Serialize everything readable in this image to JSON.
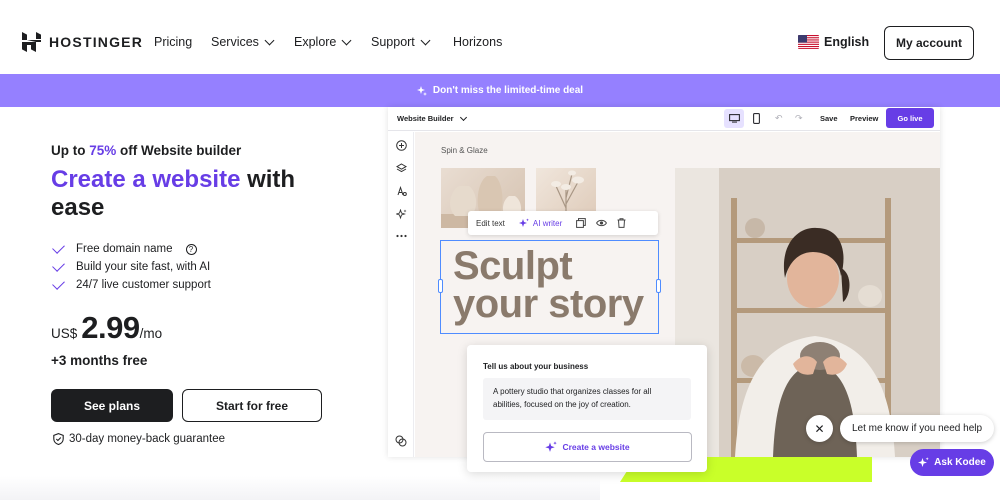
{
  "nav": {
    "logo_text": "HOSTINGER",
    "links": [
      {
        "label": "Pricing",
        "dropdown": false
      },
      {
        "label": "Services",
        "dropdown": true
      },
      {
        "label": "Explore",
        "dropdown": true
      },
      {
        "label": "Support",
        "dropdown": true
      },
      {
        "label": "Horizons",
        "dropdown": false
      }
    ],
    "language": "English",
    "account_label": "My account"
  },
  "deal_bar": {
    "text": "Don't miss the limited-time deal",
    "color": "#9580ff"
  },
  "hero": {
    "promo_prefix": "Up to ",
    "promo_discount": "75%",
    "promo_suffix": " off Website builder",
    "headline_accent": "Create a website",
    "headline_rest": " with ease",
    "features": [
      "Free domain name",
      "Build your site fast, with AI",
      "24/7 live customer support"
    ],
    "price_currency": "US$",
    "price_amount": "2.99",
    "price_period": "/mo",
    "bonus": "+3 months free",
    "primary_cta": "See plans",
    "secondary_cta": "Start for free",
    "guarantee": "30-day money-back guarantee",
    "accent_color": "#673de6"
  },
  "builder": {
    "selector_label": "Website Builder",
    "save_label": "Save",
    "preview_label": "Preview",
    "golive_label": "Go live",
    "brand": "Spin & Glaze",
    "toolbar_edit": "Edit text",
    "toolbar_ai": "AI writer",
    "heading_line1": "Sculpt",
    "heading_line2": "your story"
  },
  "ai_panel": {
    "title": "Tell us about your business",
    "text": "A pottery studio that organizes classes for all abilities, focused on the joy of creation.",
    "button_label": "Create a website"
  },
  "chat": {
    "bubble_text": "Let me know if you need help",
    "ask_label": "Ask Kodee"
  }
}
